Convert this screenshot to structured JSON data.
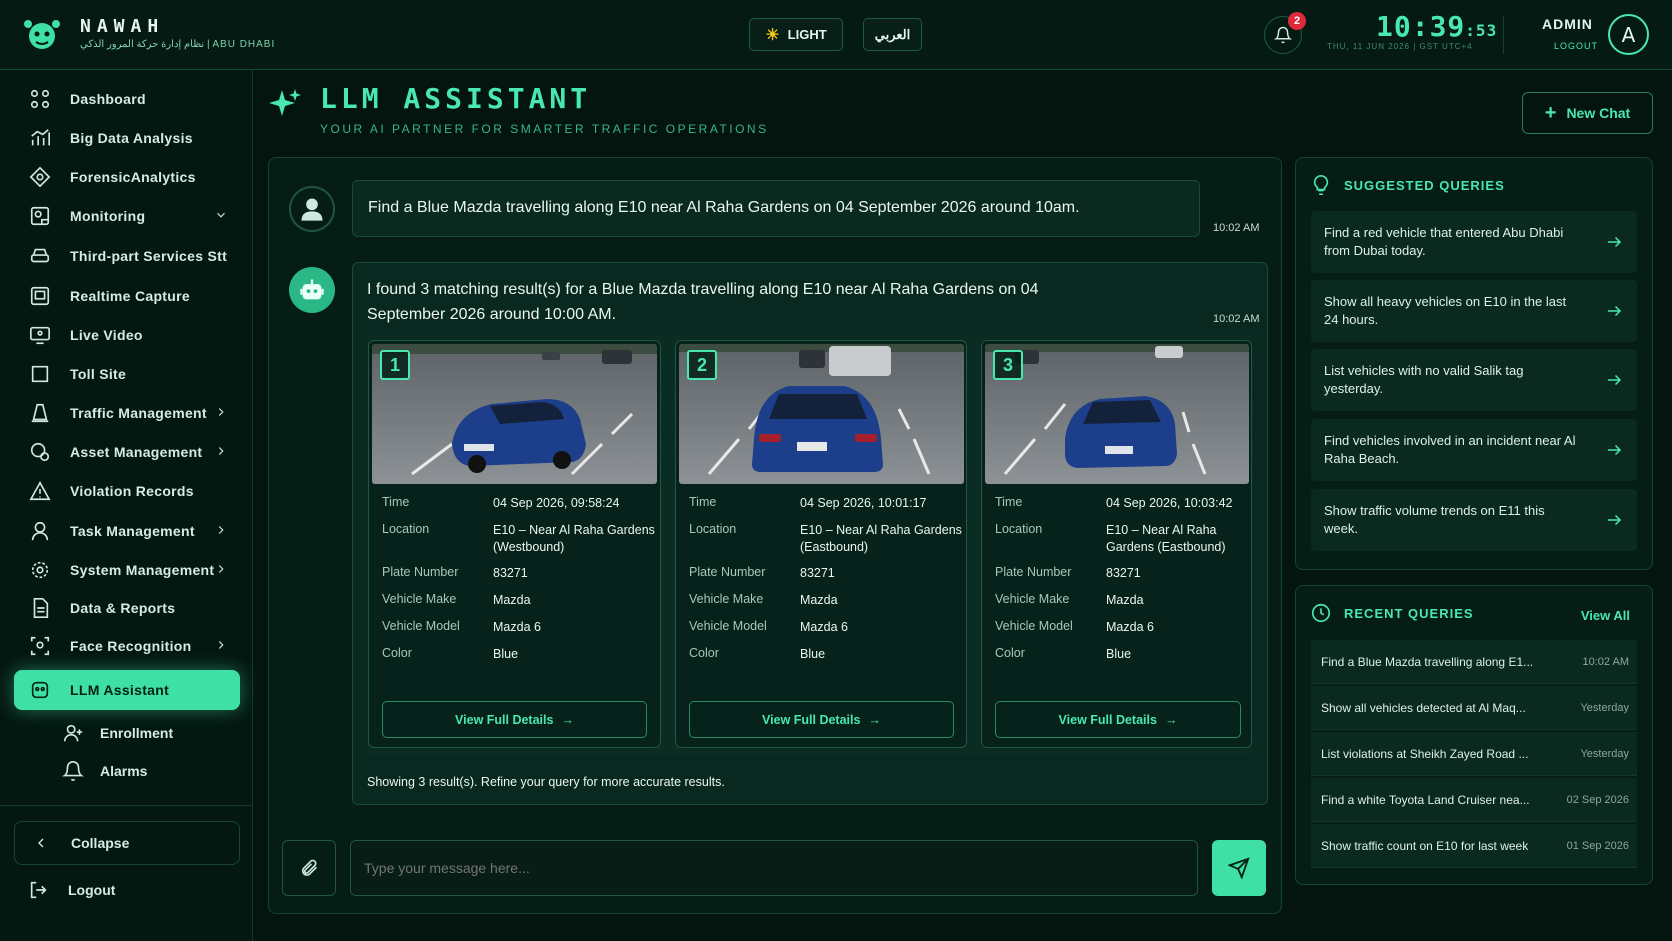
{
  "brand": {
    "name": "NAWAH",
    "subtitle": "نظام إدارة حركة المرور الذكي | ABU DHABI"
  },
  "header": {
    "theme_label": "LIGHT",
    "language_label": "العربي",
    "notification_count": "2",
    "clock_time": "10:39",
    "clock_seconds": ":53",
    "date_line": "THU, 11 JUN 2026  |  GST UTC+4",
    "user_name": "ADMIN",
    "logout_label": "LOGOUT",
    "avatar_initial": "A"
  },
  "sidebar": {
    "items": [
      {
        "label": "Dashboard"
      },
      {
        "label": "Big Data Analysis"
      },
      {
        "label": "ForensicAnalytics"
      },
      {
        "label": "Monitoring"
      },
      {
        "label": "Third-part Services Stt"
      },
      {
        "label": "Realtime Capture"
      },
      {
        "label": "Live Video"
      },
      {
        "label": "Toll Site"
      },
      {
        "label": "Traffic Management"
      },
      {
        "label": "Asset Management"
      },
      {
        "label": "Violation Records"
      },
      {
        "label": "Task Management"
      },
      {
        "label": "System Management"
      },
      {
        "label": "Data & Reports"
      },
      {
        "label": "Face Recognition"
      },
      {
        "label": "LLM Assistant"
      }
    ],
    "sub_items": [
      {
        "label": "Enrollment"
      },
      {
        "label": "Alarms"
      }
    ],
    "collapse_label": "Collapse",
    "logout_label": "Logout"
  },
  "page": {
    "title": "LLM ASSISTANT",
    "subtitle": "YOUR AI PARTNER FOR SMARTER TRAFFIC OPERATIONS",
    "new_chat_label": "New Chat"
  },
  "chat": {
    "user_message": "Find a Blue Mazda travelling along E10 near Al Raha Gardens on 04 September 2026 around 10am.",
    "user_time": "10:02 AM",
    "bot_message": "I found 3 matching result(s) for a Blue Mazda travelling along E10 near Al Raha Gardens on 04 September 2026 around 10:00 AM.",
    "bot_time": "10:02 AM",
    "field_labels": {
      "time": "Time",
      "location": "Location",
      "plate": "Plate Number",
      "make": "Vehicle Make",
      "model": "Vehicle Model",
      "color": "Color"
    },
    "results": [
      {
        "number": "1",
        "time": "04 Sep 2026, 09:58:24",
        "location": "E10 – Near Al Raha Gardens (Westbound)",
        "plate": "83271",
        "make": "Mazda",
        "model": "Mazda 6",
        "color": "Blue",
        "button": "View Full Details"
      },
      {
        "number": "2",
        "time": "04 Sep 2026, 10:01:17",
        "location": "E10 – Near Al Raha Gardens (Eastbound)",
        "plate": "83271",
        "make": "Mazda",
        "model": "Mazda 6",
        "color": "Blue",
        "button": "View Full Details"
      },
      {
        "number": "3",
        "time": "04 Sep 2026, 10:03:42",
        "location": "E10 – Near Al Raha Gardens (Eastbound)",
        "plate": "83271",
        "make": "Mazda",
        "model": "Mazda 6",
        "color": "Blue",
        "button": "View Full Details"
      }
    ],
    "footer_note": "Showing 3 result(s). Refine your query for more accurate results.",
    "input_placeholder": "Type your message here..."
  },
  "suggested": {
    "title": "SUGGESTED QUERIES",
    "items": [
      "Find a red vehicle that entered Abu Dhabi from Dubai today.",
      "Show all heavy vehicles on E10 in the last 24 hours.",
      "List vehicles with no valid Salik tag yesterday.",
      "Find vehicles involved in an incident near Al Raha Beach.",
      "Show traffic volume trends on E11 this week."
    ]
  },
  "recent": {
    "title": "RECENT QUERIES",
    "view_all": "View All",
    "items": [
      {
        "text": "Find a Blue Mazda travelling along E1...",
        "time": "10:02 AM"
      },
      {
        "text": "Show all vehicles detected at Al Maq...",
        "time": "Yesterday"
      },
      {
        "text": "List violations at Sheikh Zayed Road ...",
        "time": "Yesterday"
      },
      {
        "text": "Find a white Toyota Land Cruiser nea...",
        "time": "02 Sep 2026"
      },
      {
        "text": "Show traffic count on E10 for last week",
        "time": "01 Sep 2026"
      }
    ]
  },
  "colors": {
    "accent": "#49e8b0",
    "active_nav": "#3ee0a6",
    "background": "#04150f",
    "badge": "#e0283c"
  }
}
